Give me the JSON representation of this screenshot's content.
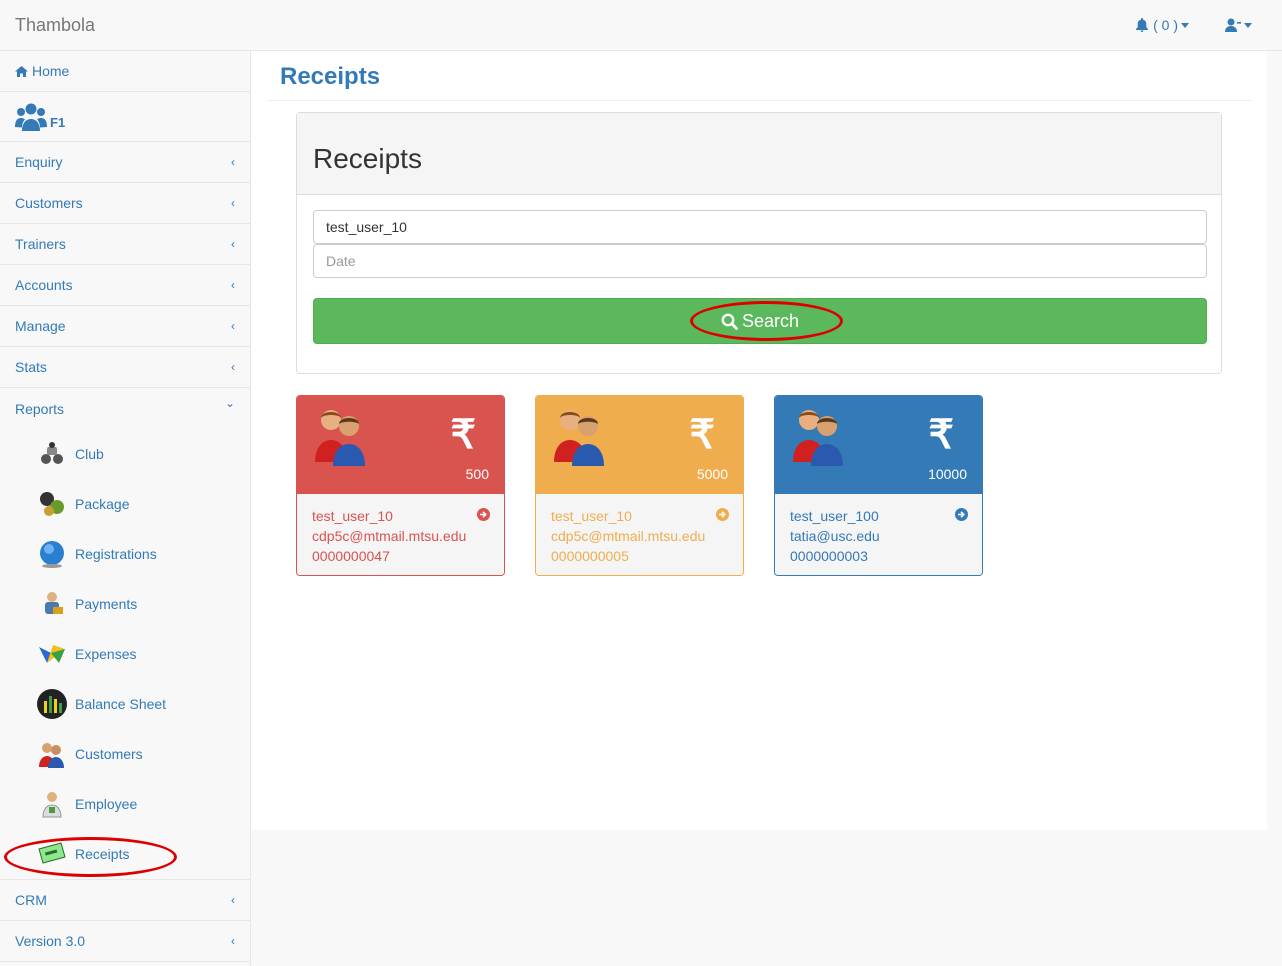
{
  "navbar": {
    "brand": "Thambola",
    "notifications": "( 0 )"
  },
  "sidebar": {
    "home": "Home",
    "profile": "F1",
    "items_top": [
      "Enquiry",
      "Customers",
      "Trainers",
      "Accounts",
      "Manage",
      "Stats"
    ],
    "reports": "Reports",
    "report_items": [
      "Club",
      "Package",
      "Registrations",
      "Payments",
      "Expenses",
      "Balance Sheet",
      "Customers",
      "Employee",
      "Receipts"
    ],
    "items_bottom": [
      "CRM",
      "Version 3.0"
    ]
  },
  "main": {
    "page_title": "Receipts",
    "panel_title": "Receipts",
    "user_value": "test_user_10",
    "date_placeholder": "Date",
    "search_label": "Search"
  },
  "cards": [
    {
      "amount": "500",
      "user": "test_user_10",
      "email": "cdp5c@mtmail.mtsu.edu",
      "receipt": "0000000047",
      "color": "#d9534f",
      "text_color": "#d9534f"
    },
    {
      "amount": "5000",
      "user": "test_user_10",
      "email": "cdp5c@mtmail.mtsu.edu",
      "receipt": "0000000005",
      "color": "#f0ad4e",
      "text_color": "#f0ad4e"
    },
    {
      "amount": "10000",
      "user": "test_user_100",
      "email": "tatia@usc.edu",
      "receipt": "0000000003",
      "color": "#337ab7",
      "text_color": "#337ab7"
    }
  ],
  "icons": {
    "rupee": "₹",
    "chevron_left": "‹",
    "chevron_down": "⌄"
  }
}
